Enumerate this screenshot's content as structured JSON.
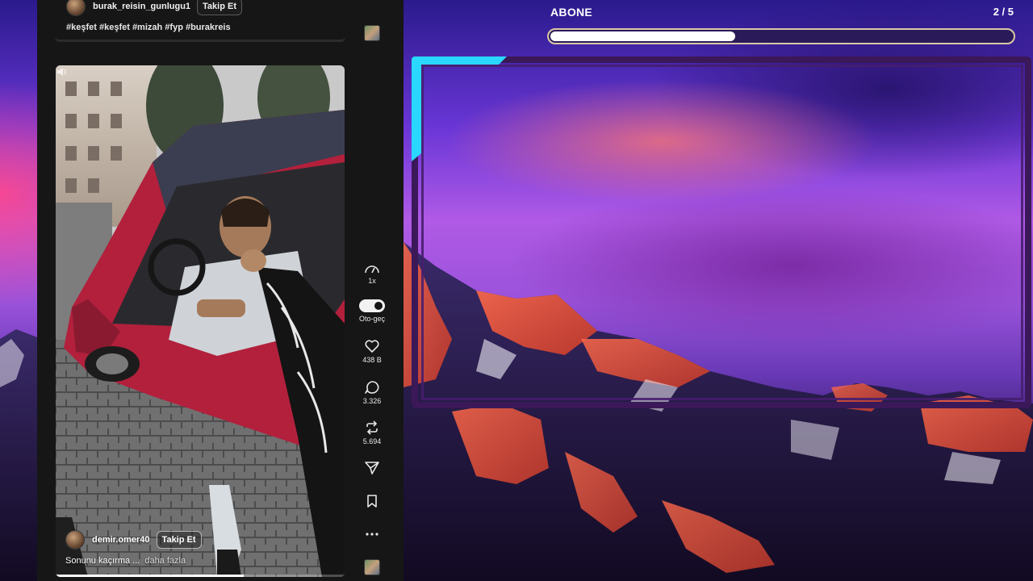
{
  "feed": {
    "previous_post": {
      "username": "burak_reisin_gunlugu1",
      "follow_label": "Takip Et",
      "hashtags": "#keşfet #keşfet #mizah #fyp #burakreis"
    },
    "current_video": {
      "username": "demir.omer40",
      "follow_label": "Takip Et",
      "caption": "Sonunu kaçırma ...",
      "more_label": "daha fazla",
      "progress_fraction": 0.65
    }
  },
  "rail": {
    "more_top_icon": "more-horizontal-icon",
    "speed_label": "1x",
    "autoplay_label": "Oto-geç",
    "autoplay_on": true,
    "likes": "438 B",
    "comments": "3.326",
    "reposts": "5.694"
  },
  "overlay": {
    "title": "ABONE",
    "count": "2 / 5",
    "progress_fraction": 0.4,
    "accent_color": "#2ad8ff",
    "frame_color": "#3b1858"
  }
}
